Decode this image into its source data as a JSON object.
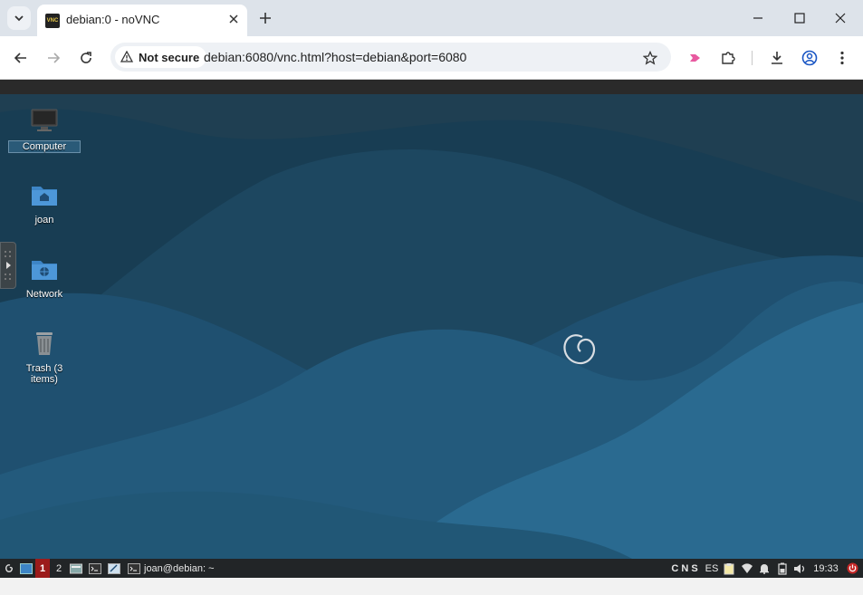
{
  "browser": {
    "tab_title": "debian:0 - noVNC",
    "favicon_text": "VNC",
    "security_label": "Not secure",
    "url": "debian:6080/vnc.html?host=debian&port=6080"
  },
  "desktop": {
    "icons": [
      {
        "label": "Computer"
      },
      {
        "label": "joan"
      },
      {
        "label": "Network"
      },
      {
        "label": "Trash (3\nitems)"
      }
    ]
  },
  "taskbar": {
    "workspaces": [
      "1",
      "2"
    ],
    "window_title": "joan@debian: ~",
    "locks": "C N S",
    "keyboard_layout": "ES",
    "clock": "19:33"
  },
  "colors": {
    "accent_red": "#9b1b1b",
    "wallpaper_dark": "#173a4f",
    "wallpaper_light": "#2a6a90"
  }
}
